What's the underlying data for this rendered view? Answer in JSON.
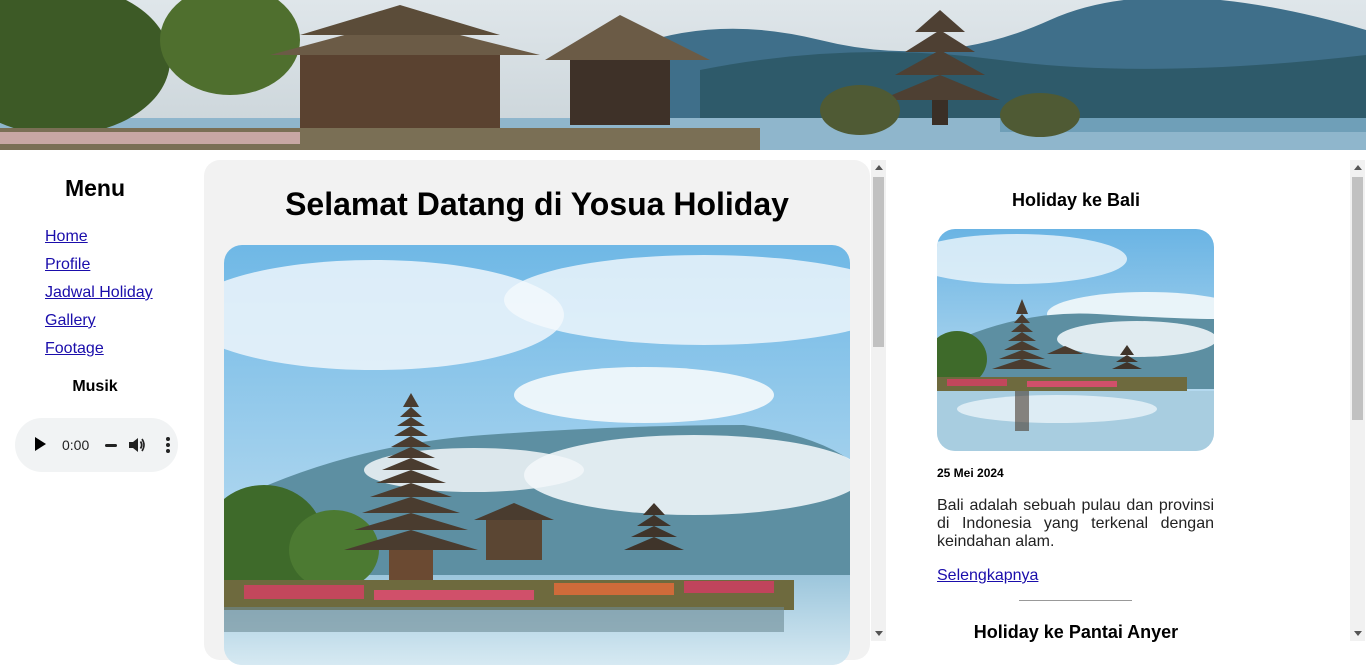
{
  "banner": {
    "image": "bali-temple-banner"
  },
  "sidebar": {
    "title": "Menu",
    "items": [
      {
        "label": "Home"
      },
      {
        "label": "Profile"
      },
      {
        "label": "Jadwal Holiday"
      },
      {
        "label": "Gallery"
      },
      {
        "label": "Footage"
      }
    ],
    "music_title": "Musik",
    "player": {
      "time": "0:00",
      "icons": [
        "play-icon",
        "volume-icon",
        "more-vert-icon"
      ]
    }
  },
  "main": {
    "title": "Selamat Datang di Yosua Holiday",
    "image": "ulun-danu-temple-photo"
  },
  "articles": [
    {
      "title": "Holiday ke Bali",
      "image": "ulun-danu-temple-thumbnail",
      "date": "25 Mei 2024",
      "text": "Bali adalah sebuah pulau dan provinsi di Indonesia yang terkenal dengan keindahan alam.",
      "link": "Selengkapnya"
    },
    {
      "title": "Holiday ke Pantai Anyer"
    }
  ],
  "colors": {
    "link": "#1a0dab",
    "panel": "#f2f2f2",
    "player": "#f1f3f4"
  }
}
